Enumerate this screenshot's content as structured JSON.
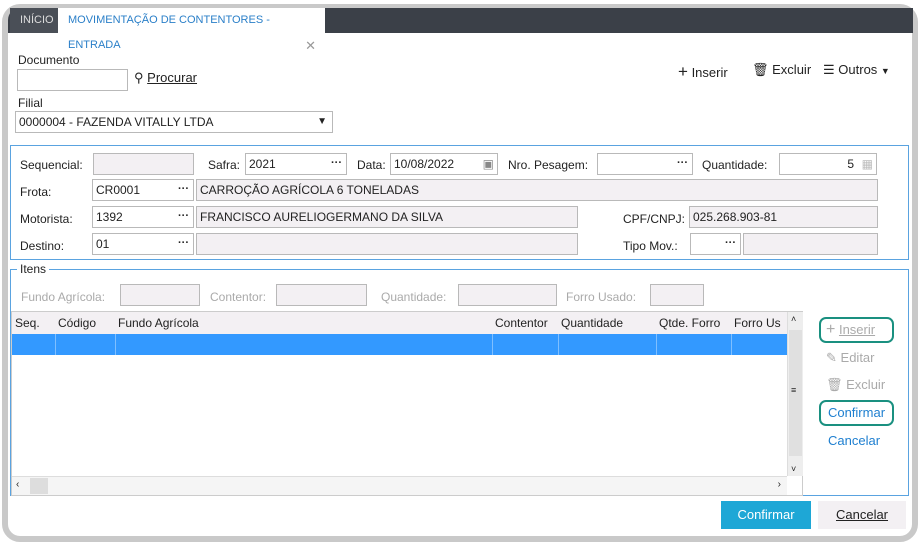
{
  "tabs": [
    {
      "label": "INÍCIO"
    },
    {
      "label": "MOVIMENTAÇÃO DE CONTENTORES - ENTRADA"
    }
  ],
  "documento": {
    "label": "Documento",
    "value": "",
    "search": "Procurar"
  },
  "toolbar": {
    "inserir": "Inserir",
    "excluir": "Excluir",
    "outros": "Outros"
  },
  "filial": {
    "label": "Filial",
    "value": "0000004 - FAZENDA VITALLY LTDA"
  },
  "header": {
    "sequencial": {
      "label": "Sequencial:",
      "value": ""
    },
    "safra": {
      "label": "Safra:",
      "value": "2021"
    },
    "data": {
      "label": "Data:",
      "value": "10/08/2022"
    },
    "pesagem": {
      "label": "Nro. Pesagem:",
      "value": ""
    },
    "quantidade": {
      "label": "Quantidade:",
      "value": "5"
    },
    "frota": {
      "label": "Frota:",
      "code": "CR0001",
      "desc": "CARROÇÃO AGRÍCOLA 6 TONELADAS"
    },
    "motorista": {
      "label": "Motorista:",
      "code": "1392",
      "desc": "FRANCISCO AURELIOGERMANO DA SILVA"
    },
    "cpf": {
      "label": "CPF/CNPJ:",
      "value": "025.268.903-81"
    },
    "destino": {
      "label": "Destino:",
      "code": "01",
      "desc": ""
    },
    "tipo": {
      "label": "Tipo Mov.:",
      "code": "",
      "desc": ""
    }
  },
  "itens": {
    "title": "Itens",
    "fundo": "Fundo Agrícola:",
    "contentor": "Contentor:",
    "quantidade": "Quantidade:",
    "forro": "Forro Usado:",
    "columns": [
      "Seq.",
      "Código",
      "Fundo Agrícola",
      "Contentor",
      "Quantidade",
      "Qtde. Forro",
      "Forro Us"
    ],
    "actions": {
      "inserir": "Inserir",
      "editar": "Editar",
      "excluir": "Excluir",
      "confirmar": "Confirmar",
      "cancelar": "Cancelar"
    }
  },
  "footer": {
    "confirmar": "Confirmar",
    "cancelar": "Cancelar"
  },
  "colors": {
    "accent": "#1ea7d6",
    "selection": "#3399ff",
    "highlight": "#1a9080",
    "tabbar": "#3b4048"
  }
}
